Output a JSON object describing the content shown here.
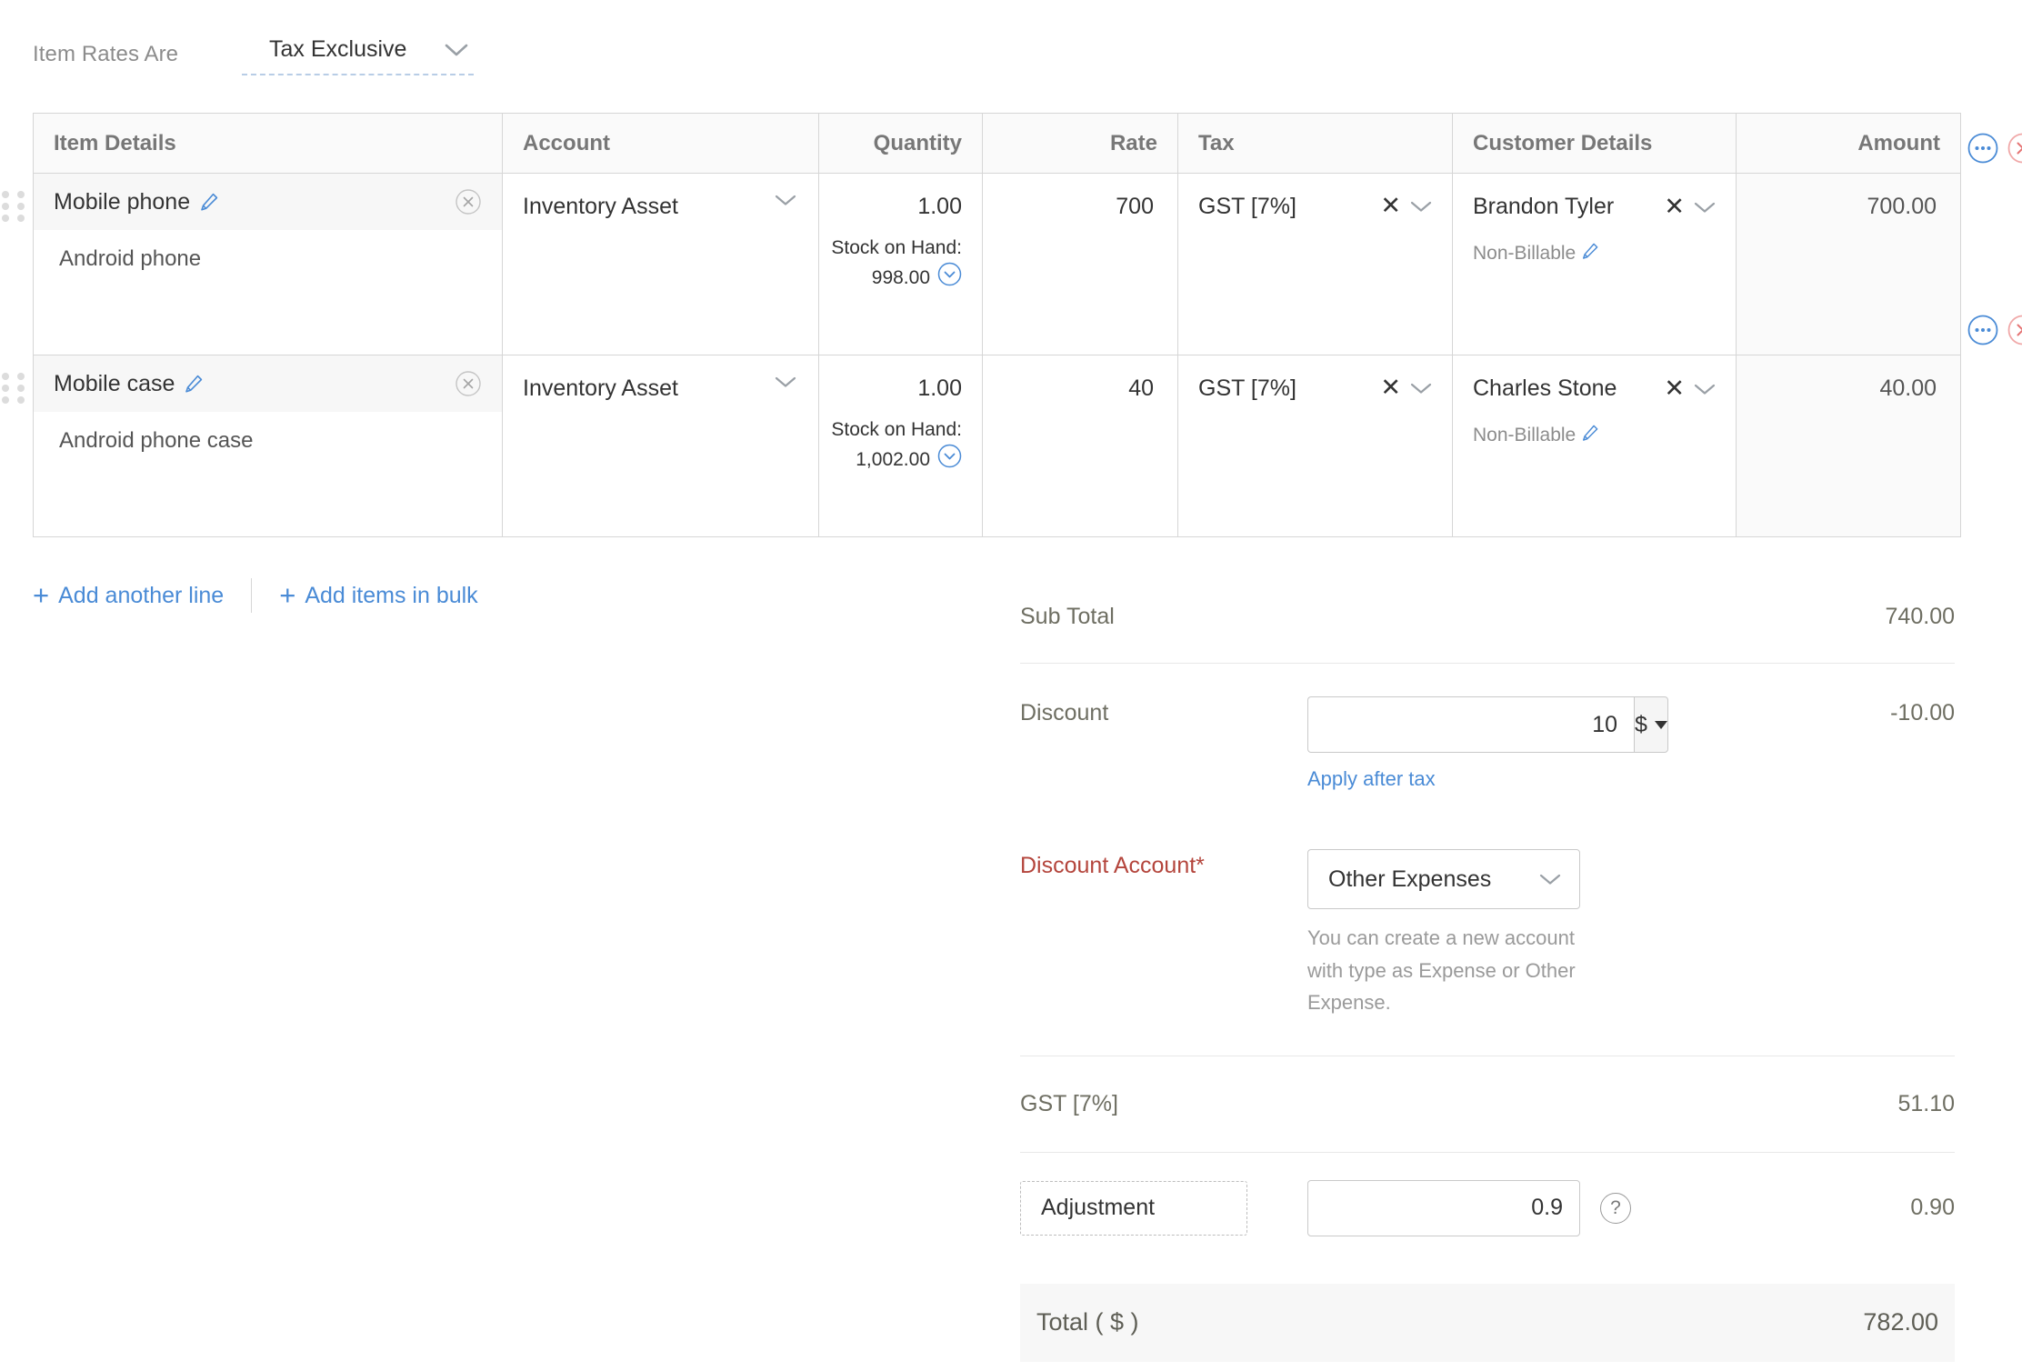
{
  "rates": {
    "label": "Item Rates Are",
    "value": "Tax Exclusive",
    "chevron_icon": "chevron-down-icon"
  },
  "table": {
    "columns": [
      {
        "key": "item",
        "label": "Item Details",
        "align": "left"
      },
      {
        "key": "account",
        "label": "Account",
        "align": "left"
      },
      {
        "key": "quantity",
        "label": "Quantity",
        "align": "right"
      },
      {
        "key": "rate",
        "label": "Rate",
        "align": "right"
      },
      {
        "key": "tax",
        "label": "Tax",
        "align": "left"
      },
      {
        "key": "customer",
        "label": "Customer Details",
        "align": "left"
      },
      {
        "key": "amount",
        "label": "Amount",
        "align": "right"
      }
    ],
    "rows": [
      {
        "name": "Mobile phone",
        "description": "Android phone",
        "account": "Inventory Asset",
        "quantity": "1.00",
        "stock_label": "Stock on Hand:",
        "stock_value": "998.00",
        "rate": "700",
        "tax": "GST [7%]",
        "customer": "Brandon Tyler",
        "billable": "Non-Billable",
        "amount": "700.00"
      },
      {
        "name": "Mobile case",
        "description": "Android phone case",
        "account": "Inventory Asset",
        "quantity": "1.00",
        "stock_label": "Stock on Hand:",
        "stock_value": "1,002.00",
        "rate": "40",
        "tax": "GST [7%]",
        "customer": "Charles Stone",
        "billable": "Non-Billable",
        "amount": "40.00"
      }
    ]
  },
  "add_actions": {
    "add_line": "Add another line",
    "add_bulk": "Add items in bulk"
  },
  "totals": {
    "sub_total_label": "Sub Total",
    "sub_total_value": "740.00",
    "discount_label": "Discount",
    "discount_input": "10",
    "discount_unit": "$",
    "discount_value": "-10.00",
    "apply_after_tax": "Apply after tax",
    "discount_account_label": "Discount Account*",
    "discount_account_value": "Other Expenses",
    "discount_account_hint": "You can create a new account with type as Expense or Other Expense.",
    "gst_label": "GST [7%]",
    "gst_value": "51.10",
    "adjustment_label": "Adjustment",
    "adjustment_input": "0.9",
    "adjustment_value": "0.90",
    "total_label": "Total ( $ )",
    "total_value": "782.00"
  },
  "colors": {
    "link": "#4a8bd6",
    "required": "#b4453c",
    "border": "#d6d6d6",
    "header_bg": "#fafafa",
    "row_name_bg": "#f7f7f7"
  }
}
